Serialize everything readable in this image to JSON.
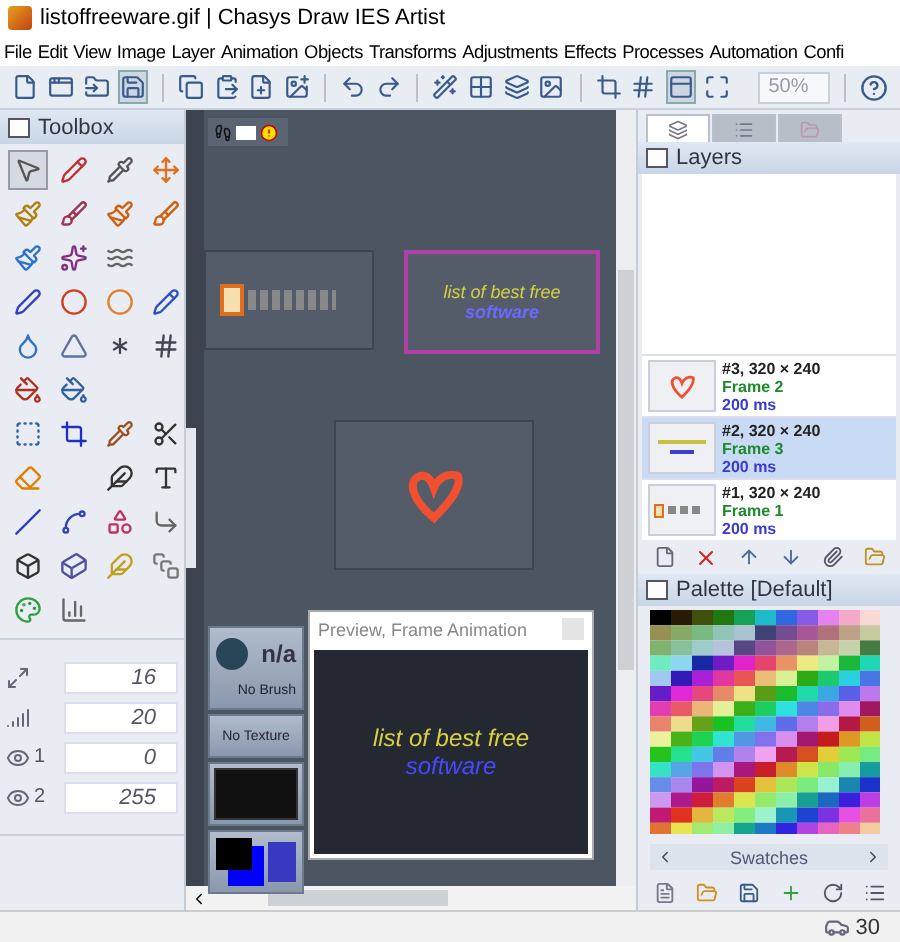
{
  "window": {
    "title": "listoffreeware.gif | Chasys Draw IES Artist"
  },
  "menu": [
    "File",
    "Edit",
    "View",
    "Image",
    "Layer",
    "Animation",
    "Objects",
    "Transforms",
    "Adjustments",
    "Effects",
    "Processes",
    "Automation",
    "Confi"
  ],
  "toolbar": {
    "zoom": "50%"
  },
  "toolbox": {
    "title": "Toolbox",
    "fields": [
      {
        "kind": "size",
        "value": "16"
      },
      {
        "kind": "bars",
        "value": "20"
      },
      {
        "kind": "eye",
        "label": "1",
        "value": "0"
      },
      {
        "kind": "eye",
        "label": "2",
        "value": "255"
      }
    ]
  },
  "canvas": {
    "frames": [
      {
        "kind": "logo",
        "selected": false
      },
      {
        "kind": "text",
        "selected": true,
        "line1": "list of best free",
        "line2": "software"
      },
      {
        "kind": "heart",
        "selected": false
      }
    ],
    "preview": {
      "title": "Preview, Frame Animation",
      "line1": "list of best free",
      "line2": "software"
    },
    "brush": {
      "size": "n/a",
      "name": "No Brush"
    },
    "texture": "No Texture"
  },
  "panel_tabs": [
    {
      "selected": true
    },
    {
      "selected": false
    },
    {
      "selected": false
    }
  ],
  "layers": {
    "title": "Layers",
    "items": [
      {
        "name": "#3, 320 × 240",
        "frame": "Frame 2",
        "delay": "200 ms",
        "kind": "heart",
        "selected": false
      },
      {
        "name": "#2, 320 × 240",
        "frame": "Frame 3",
        "delay": "200 ms",
        "kind": "text",
        "selected": true
      },
      {
        "name": "#1, 320 × 240",
        "frame": "Frame 1",
        "delay": "200 ms",
        "kind": "logo",
        "selected": false
      }
    ]
  },
  "palette": {
    "title": "Palette [Default]",
    "swatches": "Swatches"
  },
  "status_bar": {
    "count": "30"
  }
}
